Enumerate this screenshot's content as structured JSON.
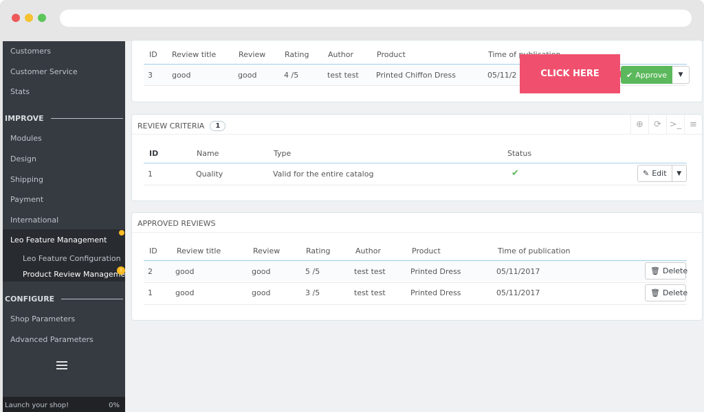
{
  "sidebar": {
    "items_top": [
      "Customers",
      "Customer Service",
      "Stats"
    ],
    "section_improve": "IMPROVE",
    "items_improve": [
      "Modules",
      "Design",
      "Shipping",
      "Payment",
      "International"
    ],
    "active_item": "Leo Feature Management",
    "sub_items": [
      "Leo Feature Configuration",
      "Product Review Manageme..."
    ],
    "sub_badge": "!",
    "section_configure": "CONFIGURE",
    "items_configure": [
      "Shop Parameters",
      "Advanced Parameters"
    ],
    "launch_label": "Launch your shop!",
    "launch_progress": "0%"
  },
  "pending": {
    "columns": [
      "ID",
      "Review title",
      "Review",
      "Rating",
      "Author",
      "Product",
      "Time of publication"
    ],
    "row": [
      "3",
      "good",
      "good",
      "4 /5",
      "test test",
      "Printed Chiffon Dress",
      "05/11/2"
    ],
    "approve_label": "Approve",
    "callout": "CLICK HERE"
  },
  "criteria": {
    "title": "REVIEW CRITERIA",
    "count": "1",
    "columns": [
      "ID",
      "Name",
      "Type",
      "Status"
    ],
    "row": [
      "1",
      "Quality",
      "Valid for the entire catalog"
    ],
    "edit_label": "Edit"
  },
  "approved": {
    "title": "APPROVED REVIEWS",
    "columns": [
      "ID",
      "Review title",
      "Review",
      "Rating",
      "Author",
      "Product",
      "Time of publication"
    ],
    "rows": [
      [
        "2",
        "good",
        "good",
        "5 /5",
        "test test",
        "Printed Dress",
        "05/11/2017"
      ],
      [
        "1",
        "good",
        "good",
        "3 /5",
        "test test",
        "Printed Dress",
        "05/11/2017"
      ]
    ],
    "delete_label": "Delete"
  },
  "colors": {
    "accent": "#f0506e",
    "approve": "#5cb85c",
    "sidebar": "#363a41",
    "badge": "#fbbb22"
  }
}
